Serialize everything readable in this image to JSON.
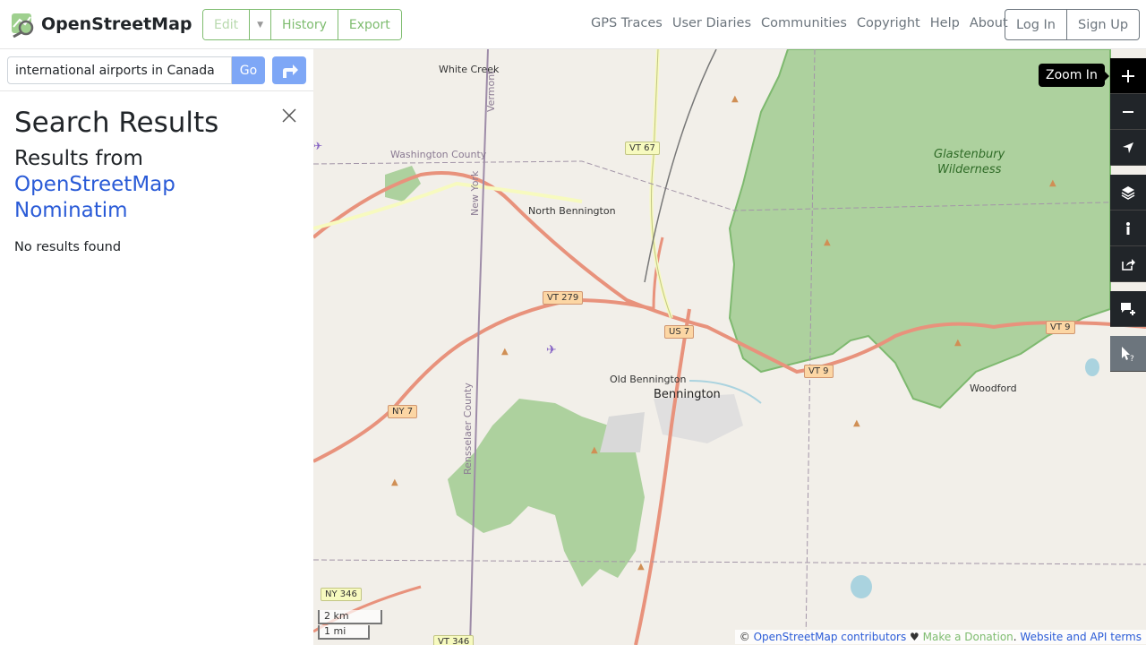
{
  "header": {
    "brand": "OpenStreetMap",
    "edit": "Edit",
    "history": "History",
    "export": "Export",
    "nav": [
      "GPS Traces",
      "User Diaries",
      "Communities",
      "Copyright",
      "Help",
      "About"
    ],
    "login": "Log In",
    "signup": "Sign Up"
  },
  "search": {
    "query": "international airports in Canada",
    "go": "Go"
  },
  "results": {
    "title": "Search Results",
    "from_prefix": "Results from",
    "source_line1": "OpenStreetMap",
    "source_line2": "Nominatim",
    "empty": "No results found"
  },
  "map": {
    "labels": {
      "white_creek": "White Creek",
      "washington_county": "Washington County",
      "vermont": "Vermont",
      "new_york": "New York",
      "north_bennington": "North Bennington",
      "old_bennington": "Old Bennington",
      "bennington": "Bennington",
      "rensselaer_county": "Rensselaer County",
      "glastenbury": "Glastenbury",
      "wilderness": "Wilderness",
      "woodford": "Woodford"
    },
    "shields": {
      "vt67": "VT 67",
      "vt279": "VT 279",
      "us7": "US 7",
      "vt9a": "VT 9",
      "vt9b": "VT 9",
      "ny7": "NY 7",
      "ny346": "NY 346",
      "vt346": "VT 346"
    },
    "tooltip": "Zoom In",
    "scale_km": "2 km",
    "scale_mi": "1 mi"
  },
  "attribution": {
    "copy": "©",
    "contributors": "OpenStreetMap contributors",
    "heart": "♥",
    "donate": "Make a Donation",
    "terms": "Website and API terms"
  }
}
